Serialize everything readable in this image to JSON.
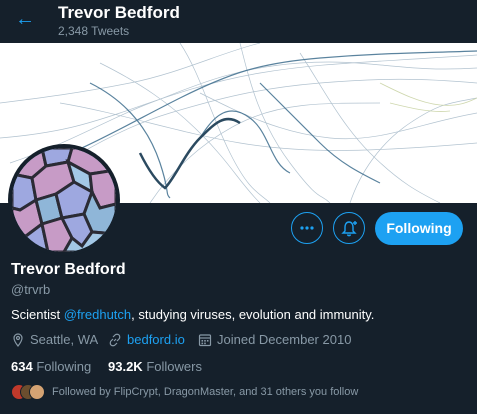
{
  "header": {
    "back_icon": "arrow-left-icon",
    "name": "Trevor Bedford",
    "tweet_count": "2,348 Tweets"
  },
  "profile": {
    "name": "Trevor Bedford",
    "handle": "@trvrb",
    "bio_prefix": "Scientist ",
    "bio_mention": "@fredhutch",
    "bio_suffix": ", studying viruses, evolution and immunity.",
    "location": "Seattle, WA",
    "website": "bedford.io",
    "joined": "Joined December 2010",
    "following_count": "634",
    "following_label": "Following",
    "followers_count": "93.2K",
    "followers_label": "Followers",
    "followed_by": "Followed by FlipCrypt, DragonMaster, and 31 others you follow"
  },
  "actions": {
    "more_icon": "more-options-icon",
    "notify_icon": "notification-bell-icon",
    "follow_label": "Following"
  },
  "colors": {
    "background": "#15202b",
    "accent": "#1da1f2",
    "secondary_text": "#8899a6"
  }
}
